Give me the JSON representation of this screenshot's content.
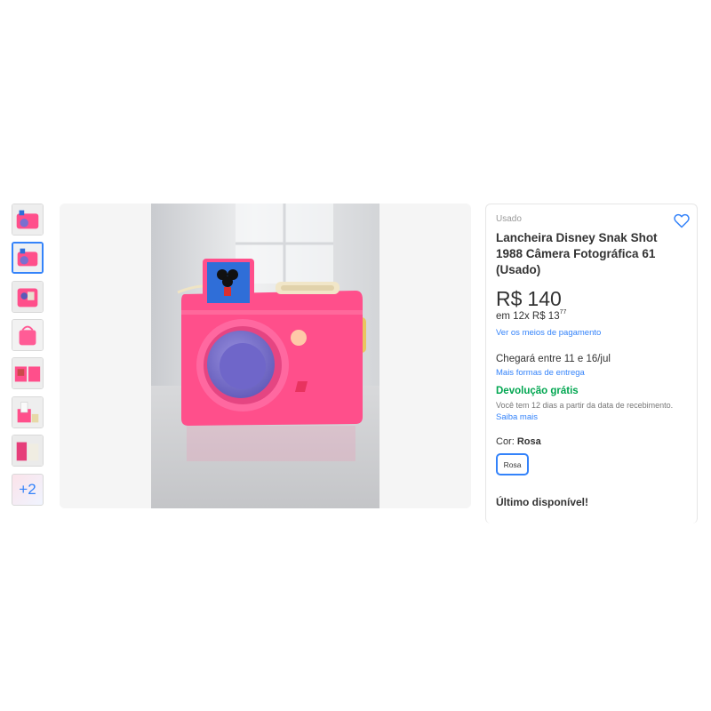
{
  "gallery": {
    "thumbnails": [
      {
        "icon": "camera-photo-thumbnail"
      },
      {
        "icon": "camera-photo-thumbnail",
        "selected": true
      },
      {
        "icon": "camera-back-photo-thumbnail"
      },
      {
        "icon": "camera-side-photo-thumbnail"
      },
      {
        "icon": "camera-open-photo-thumbnail"
      },
      {
        "icon": "camera-contents-photo-thumbnail"
      },
      {
        "icon": "camera-top-photo-thumbnail"
      }
    ],
    "more_label": "+2",
    "main_image": "pink-mickey-camera-lunchbox-photo"
  },
  "product": {
    "condition": "Usado",
    "title": "Lancheira Disney Snak Shot 1988 Câmera Fotográfica 61 (Usado)",
    "price_currency": "R$",
    "price_value": "140",
    "installments_prefix": "em 12x R$ 13",
    "installments_cents": "77",
    "payment_link": "Ver os meios de pagamento",
    "delivery": "Chegará entre 11 e 16/jul",
    "delivery_link": "Mais formas de entrega",
    "returns_title": "Devolução grátis",
    "returns_desc": "Você tem 12 dias a partir da data de recebimento.",
    "returns_link": "Saiba mais",
    "color_label": "Cor:",
    "color_value": "Rosa",
    "color_option": "Rosa",
    "stock_status": "Último disponível!",
    "favorite_icon": "heart-outline-icon"
  },
  "colors": {
    "accent": "#3483fa",
    "success": "#00a650",
    "camera_pink": "#ff4f8b",
    "lens_purple": "#7a6fd0"
  }
}
